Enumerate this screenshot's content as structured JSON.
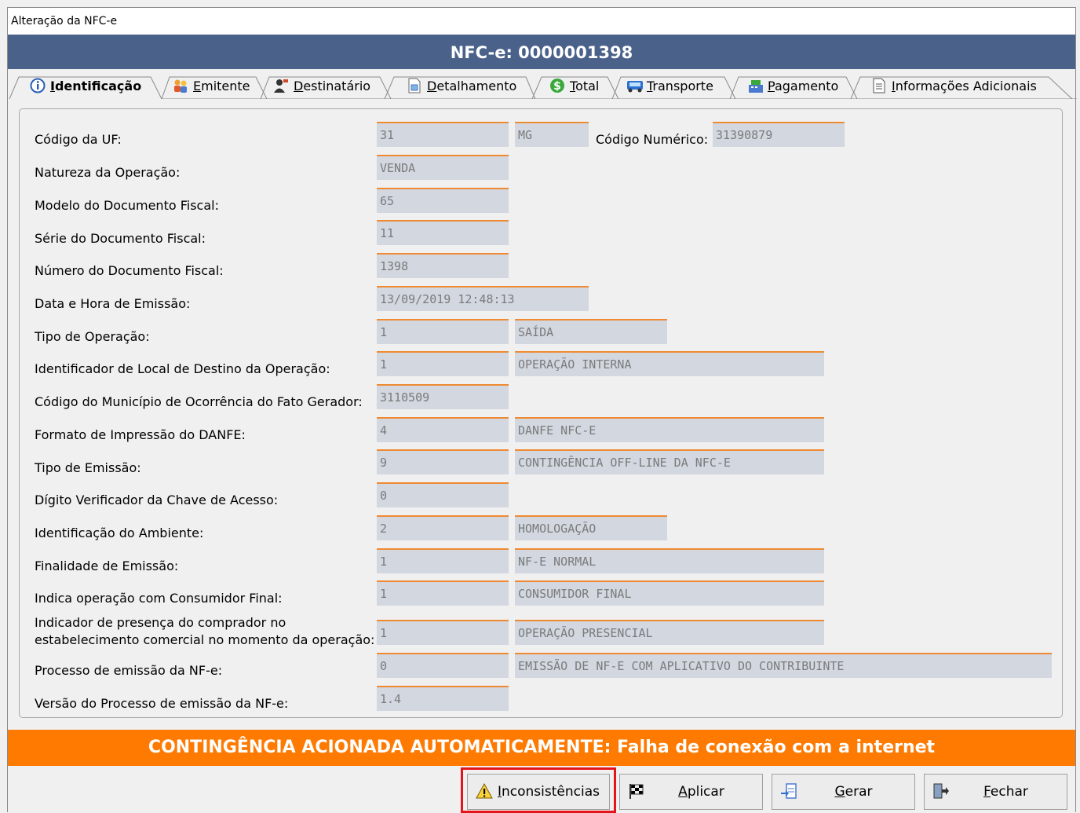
{
  "window": {
    "title": "Alteração da NFC-e"
  },
  "header": {
    "title": "NFC-e: 0000001398"
  },
  "tabs": [
    {
      "label": "Identificação",
      "icon": "info-icon",
      "active": true
    },
    {
      "label": "Emitente",
      "icon": "users-icon"
    },
    {
      "label": "Destinatário",
      "icon": "user-card-icon"
    },
    {
      "label": "Detalhamento",
      "icon": "spreadsheet-icon"
    },
    {
      "label": "Total",
      "icon": "dollar-icon"
    },
    {
      "label": "Transporte",
      "icon": "truck-icon"
    },
    {
      "label": "Pagamento",
      "icon": "cash-register-icon"
    },
    {
      "label": "Informações Adicionais",
      "icon": "document-icon"
    }
  ],
  "form": {
    "cod_uf": {
      "label": "Código da UF:",
      "value": "31",
      "desc": "MG"
    },
    "cod_numerico": {
      "label": "Código Numérico:",
      "value": "31390879"
    },
    "natureza": {
      "label": "Natureza da Operação:",
      "value": "VENDA"
    },
    "modelo": {
      "label": "Modelo do Documento Fiscal:",
      "value": "65"
    },
    "serie": {
      "label": "Série do Documento Fiscal:",
      "value": "11"
    },
    "numero": {
      "label": "Número do Documento Fiscal:",
      "value": "1398"
    },
    "data_hora": {
      "label": "Data e Hora de Emissão:",
      "value": "13/09/2019 12:48:13"
    },
    "tipo_operacao": {
      "label": "Tipo de Operação:",
      "value": "1",
      "desc": "SAÍDA"
    },
    "local_destino": {
      "label": "Identificador de Local de Destino da Operação:",
      "value": "1",
      "desc": "OPERAÇÃO INTERNA"
    },
    "municipio": {
      "label": "Código do Município de Ocorrência do Fato Gerador:",
      "value": "3110509"
    },
    "formato_danfe": {
      "label": "Formato de Impressão do DANFE:",
      "value": "4",
      "desc": "DANFE NFC-E"
    },
    "tipo_emissao": {
      "label": "Tipo de Emissão:",
      "value": "9",
      "desc": "CONTINGÊNCIA OFF-LINE DA NFC-E"
    },
    "digito": {
      "label": "Dígito Verificador da Chave de Acesso:",
      "value": "0"
    },
    "ambiente": {
      "label": "Identificação do Ambiente:",
      "value": "2",
      "desc": "HOMOLOGAÇÃO"
    },
    "finalidade": {
      "label": "Finalidade de Emissão:",
      "value": "1",
      "desc": "NF-E NORMAL"
    },
    "consumidor": {
      "label": "Indica operação com Consumidor Final:",
      "value": "1",
      "desc": "CONSUMIDOR FINAL"
    },
    "presenca": {
      "label_1": "Indicador de presença do comprador no",
      "label_2": "estabelecimento comercial no momento da operação:",
      "value": "1",
      "desc": "OPERAÇÃO PRESENCIAL"
    },
    "processo": {
      "label": "Processo de emissão da NF-e:",
      "value": "0",
      "desc": "EMISSÃO DE NF-E COM APLICATIVO DO CONTRIBUINTE"
    },
    "versao": {
      "label": "Versão do Processo de emissão da NF-e:",
      "value": "1.4"
    }
  },
  "status": {
    "message": "CONTINGÊNCIA ACIONADA AUTOMATICAMENTE: Falha de conexão com a internet",
    "color": "#ff7a00"
  },
  "buttons": {
    "inconsistencias": "Inconsistências",
    "aplicar": "Aplicar",
    "gerar": "Gerar",
    "fechar": "Fechar"
  },
  "colors": {
    "header": "#4a6189",
    "field_bg": "#d2d7e0",
    "field_border": "#ef8a32",
    "highlight": "#e3141b"
  }
}
